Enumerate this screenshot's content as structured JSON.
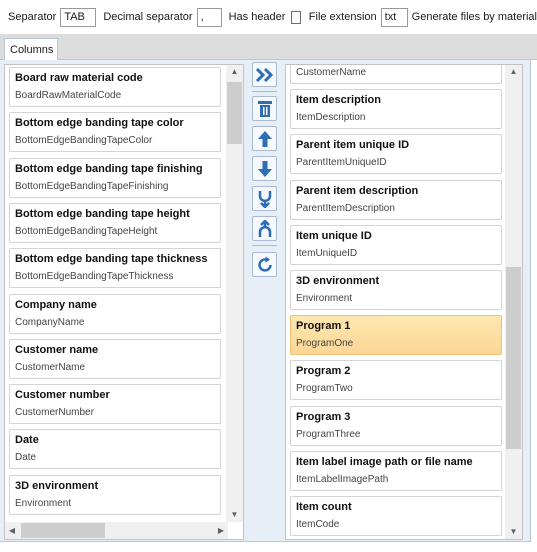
{
  "toolbar": {
    "separator_label": "Separator",
    "separator_value": "TAB",
    "decimal_label": "Decimal separator",
    "decimal_value": ",",
    "has_header_label": "Has header",
    "file_ext_label": "File extension",
    "file_ext_value": "txt",
    "generate_label": "Generate files by material"
  },
  "tabs": [
    {
      "label": "Columns"
    }
  ],
  "available_columns": [
    {
      "title": "Board raw material code",
      "key": "BoardRawMaterialCode"
    },
    {
      "title": "Bottom edge banding tape color",
      "key": "BottomEdgeBandingTapeColor"
    },
    {
      "title": "Bottom edge banding tape finishing",
      "key": "BottomEdgeBandingTapeFinishing"
    },
    {
      "title": "Bottom edge banding tape height",
      "key": "BottomEdgeBandingTapeHeight"
    },
    {
      "title": "Bottom edge banding tape thickness",
      "key": "BottomEdgeBandingTapeThickness"
    },
    {
      "title": "Company name",
      "key": "CompanyName"
    },
    {
      "title": "Customer name",
      "key": "CustomerName"
    },
    {
      "title": "Customer number",
      "key": "CustomerNumber"
    },
    {
      "title": "Date",
      "key": "Date"
    },
    {
      "title": "3D environment",
      "key": "Environment"
    }
  ],
  "selected_columns": [
    {
      "title": "",
      "key": "CustomerName"
    },
    {
      "title": "Item description",
      "key": "ItemDescription"
    },
    {
      "title": "Parent item unique ID",
      "key": "ParentItemUniqueID"
    },
    {
      "title": "Parent item description",
      "key": "ParentItemDescription"
    },
    {
      "title": "Item unique ID",
      "key": "ItemUniqueID"
    },
    {
      "title": "3D environment",
      "key": "Environment"
    },
    {
      "title": "Program 1",
      "key": "ProgramOne",
      "selected": true
    },
    {
      "title": "Program 2",
      "key": "ProgramTwo"
    },
    {
      "title": "Program 3",
      "key": "ProgramThree"
    },
    {
      "title": "Item label image path or file name",
      "key": "ItemLabelImagePath"
    },
    {
      "title": "Item count",
      "key": "ItemCode"
    }
  ],
  "buttons": [
    {
      "name": "add-selected-button",
      "icon": "double-chevron-right-icon"
    },
    {
      "name": "delete-button",
      "icon": "trash-icon"
    },
    {
      "name": "move-up-button",
      "icon": "arrow-up-icon"
    },
    {
      "name": "move-down-button",
      "icon": "arrow-down-icon"
    },
    {
      "name": "merge-button",
      "icon": "merge-icon"
    },
    {
      "name": "split-button",
      "icon": "split-icon"
    },
    {
      "name": "refresh-button",
      "icon": "refresh-icon"
    }
  ],
  "colors": {
    "accent": "#2d6db5",
    "selected_item": "#fcd796",
    "panel_background": "#e6eef8"
  }
}
